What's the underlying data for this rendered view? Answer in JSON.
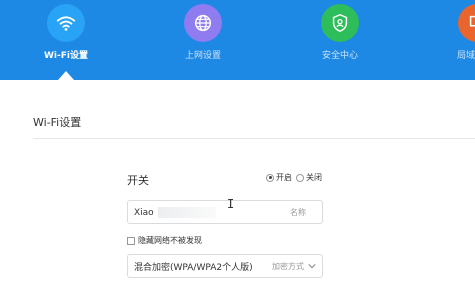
{
  "nav": {
    "items": [
      {
        "label": "Wi-Fi设置",
        "color": "#29a3f5",
        "icon": "wifi-icon",
        "active": true
      },
      {
        "label": "上网设置",
        "color": "#8e7cf0",
        "icon": "globe-icon",
        "active": false
      },
      {
        "label": "安全中心",
        "color": "#2dbd5a",
        "icon": "shield-user-icon",
        "active": false
      },
      {
        "label": "局域",
        "color": "#e8652e",
        "icon": "lan-icon",
        "active": false
      }
    ],
    "bar_color": "#1e88e5"
  },
  "section": {
    "title": "Wi-Fi设置"
  },
  "wifi": {
    "switch_label": "开关",
    "radio_on_label": "开启",
    "radio_off_label": "关闭",
    "radio_selected": "开启",
    "ssid_value": "Xiao",
    "ssid_hint": "名称",
    "hidden_checkbox_label": "隐藏网络不被发现",
    "encryption_value": "混合加密(WPA/WPA2个人版)",
    "encryption_hint": "加密方式"
  }
}
